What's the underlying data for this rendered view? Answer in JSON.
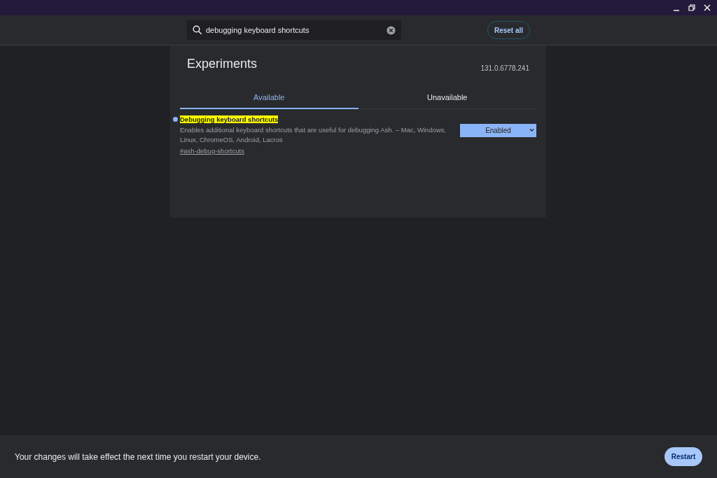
{
  "search": {
    "value": "debugging keyboard shortcuts"
  },
  "reset_button": "Reset all",
  "title": "Experiments",
  "version": "131.0.6778.241",
  "tabs": [
    {
      "label": "Available",
      "selected": true
    },
    {
      "label": "Unavailable",
      "selected": false
    }
  ],
  "flags": [
    {
      "title": "Debugging keyboard shortcuts",
      "modified": true,
      "search_match": true,
      "description": "Enables additional keyboard shortcuts that are useful for debugging Ash. – Mac, Windows, Linux, ChromeOS, Android, Lacros",
      "link": "#ash-debug-shortcuts",
      "value": "Enabled"
    }
  ],
  "footer": {
    "message": "Your changes will take effect the next time you restart your device.",
    "button": "Restart"
  }
}
